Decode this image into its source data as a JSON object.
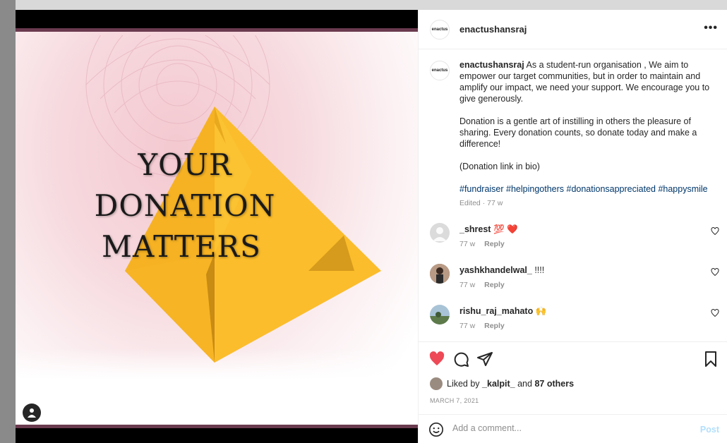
{
  "post": {
    "image": {
      "headline_lines": [
        "YOUR",
        "DONATION",
        "MATTERS"
      ]
    },
    "header": {
      "username": "enactushansraj",
      "more_label": "•••",
      "logo_text": "enactus"
    },
    "caption": {
      "username": "enactushansraj",
      "para1": "As a student-run organisation , We aim to empower our target communities, but in order to maintain and amplify our impact, we need your support. We encourage you to give generously.",
      "para2": "Donation is a gentle art of instilling in others the pleasure of sharing. Every donation counts, so donate today and make a difference!",
      "para3": "(Donation link in bio)",
      "hashtags": "#fundraiser #helpingothers #donationsappreciated #happysmile",
      "meta": "Edited · 77 w"
    },
    "comments": [
      {
        "username": "_shrest",
        "text": "💯 ❤️",
        "age": "77 w",
        "reply": "Reply"
      },
      {
        "username": "yashkhandelwal_",
        "text": "!!!!",
        "age": "77 w",
        "reply": "Reply"
      },
      {
        "username": "rishu_raj_mahato",
        "text": "🙌",
        "age": "77 w",
        "reply": "Reply"
      }
    ],
    "likes": {
      "prefix": "Liked by",
      "user": "_kalpit_",
      "and": "and",
      "others": "87 others"
    },
    "date": "MARCH 7, 2021",
    "comment_box": {
      "placeholder": "Add a comment...",
      "post_label": "Post"
    },
    "colors": {
      "like_red": "#ed4956",
      "link_blue": "#00376b",
      "triangle_yellow": "#fbbd2b",
      "post_disabled": "#b2dffc"
    }
  }
}
